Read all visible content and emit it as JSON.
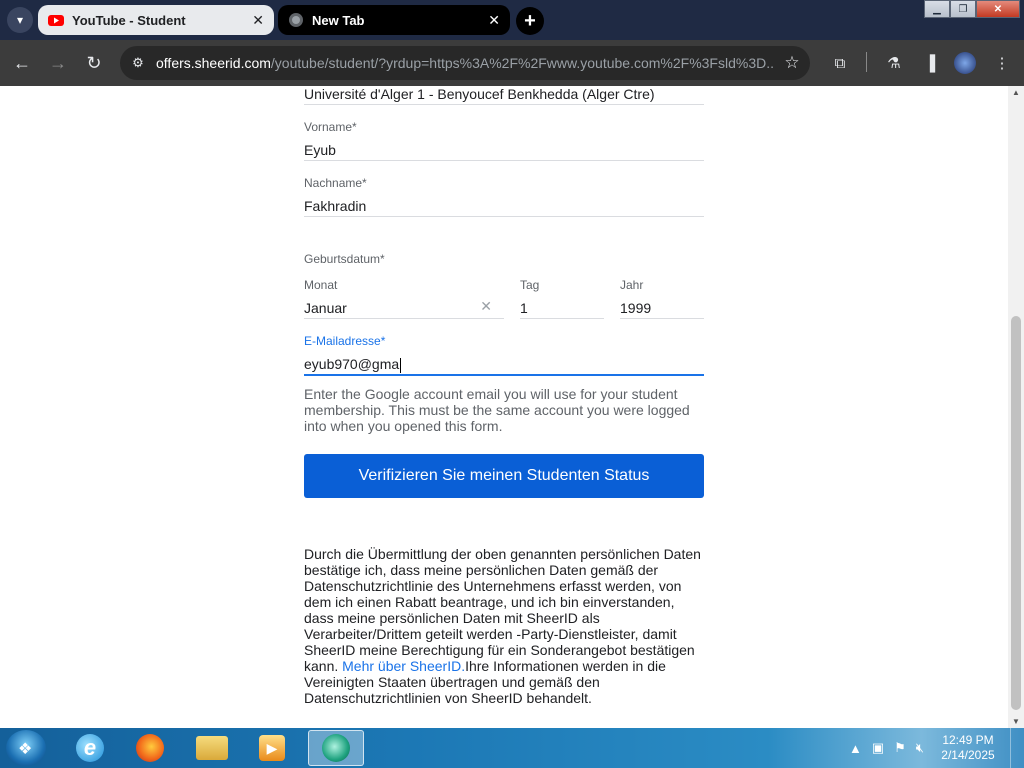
{
  "browser": {
    "tabs": [
      {
        "title": "YouTube - Student",
        "active": true,
        "favicon": "youtube-icon"
      },
      {
        "title": "New Tab",
        "active": false,
        "favicon": "globe-icon"
      }
    ],
    "url_host": "offers.sheerid.com",
    "url_path": "/youtube/student/?yrdup=https%3A%2F%2Fwww.youtube.com%2F%3Fsld%3D..."
  },
  "form": {
    "university_value": "Université d'Alger 1 - Benyoucef Benkhedda (Alger Ctre)",
    "firstname_label": "Vorname*",
    "firstname_value": "Eyub",
    "lastname_label": "Nachname*",
    "lastname_value": "Fakhradin",
    "birthdate_label": "Geburtsdatum*",
    "month_label": "Monat",
    "month_value": "Januar",
    "month_clear_icon": "close-icon",
    "day_label": "Tag",
    "day_value": "1",
    "year_label": "Jahr",
    "year_value": "1999",
    "email_label": "E-Mailadresse*",
    "email_value": "eyub970@gma",
    "email_helper": "Enter the Google account email you will use for your student membership. This must be the same account you were logged into when you opened this form.",
    "submit_label": "Verifizieren Sie meinen Studenten Status",
    "legal_text_1": "Durch die Übermittlung der oben genannten persönlichen Daten bestätige ich, dass meine persönlichen Daten gemäß der Datenschutzrichtlinie des Unternehmens erfasst werden, von dem ich einen Rabatt beantrage, und ich bin einverstanden, dass meine persönlichen Daten mit SheerID als Verarbeiter/Drittem geteilt werden -Party-Dienstleister, damit SheerID meine Berechtigung für ein Sonderangebot bestätigen kann. ",
    "legal_link": "Mehr über SheerID.",
    "legal_text_2": "Ihre Informationen werden in die Vereinigten Staaten übertragen und gemäß den Datenschutzrichtlinien von SheerID behandelt."
  },
  "taskbar": {
    "time": "12:49 PM",
    "date": "2/14/2025",
    "apps": [
      "internet-explorer-icon",
      "firefox-icon",
      "file-explorer-icon",
      "media-player-icon",
      "chrome-like-app-icon"
    ]
  },
  "colors": {
    "accent": "#1a73e8",
    "button": "#0a5fd6"
  }
}
